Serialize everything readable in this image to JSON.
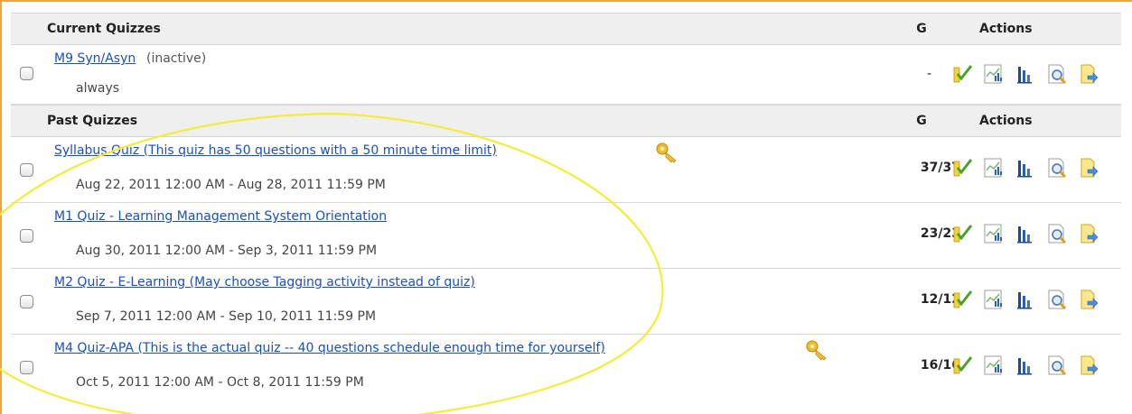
{
  "headers": {
    "current": {
      "title": "Current Quizzes",
      "g": "G",
      "actions": "Actions"
    },
    "past": {
      "title": "Past Quizzes",
      "g": "G",
      "actions": "Actions"
    }
  },
  "current_quizzes": [
    {
      "name": "M9 Syn/Asyn",
      "status": "(inactive)",
      "availability": "always",
      "grade": "-"
    }
  ],
  "past_quizzes": [
    {
      "name": "Syllabus Quiz (This quiz has 50 questions with a 50 minute time limit)",
      "dates": "Aug 22, 2011 12:00 AM - Aug 28, 2011 11:59 PM",
      "grade": "37/37",
      "has_key": true
    },
    {
      "name": "M1 Quiz - Learning Management System Orientation",
      "dates": "Aug 30, 2011 12:00 AM - Sep 3, 2011 11:59 PM",
      "grade": "23/23",
      "has_key": false
    },
    {
      "name": "M2 Quiz - E-Learning (May choose Tagging activity instead of quiz)",
      "dates": "Sep 7, 2011 12:00 AM - Sep 10, 2011 11:59 PM",
      "grade": "12/12",
      "has_key": false
    },
    {
      "name": "M4 Quiz-APA (This is the actual quiz -- 40 questions schedule enough time for yourself)",
      "dates": "Oct 5, 2011 12:00 AM - Oct 8, 2011 11:59 PM",
      "grade": "16/16",
      "has_key": true
    }
  ],
  "action_icons": [
    "grade-check-icon",
    "stats-chart-icon",
    "bar-chart-icon",
    "preview-magnifier-icon",
    "export-document-icon"
  ],
  "colors": {
    "frame": "#f3a23c",
    "link": "#1a4fc3",
    "header_bg": "#efefef",
    "annotation": "#f4ec3a"
  }
}
